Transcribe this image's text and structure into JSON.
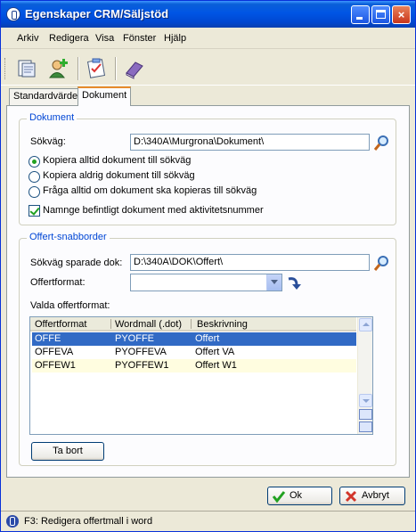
{
  "window": {
    "title": "Egenskaper CRM/Säljstöd"
  },
  "titlebar_buttons": {
    "minimize": "minimize-icon",
    "maximize": "maximize-icon",
    "close": "×"
  },
  "menu": [
    "Arkiv",
    "Redigera",
    "Visa",
    "Fönster",
    "Hjälp"
  ],
  "toolbar": {
    "icons": [
      "properties-icon",
      "add-user-icon",
      "checklist-icon",
      "book-icon"
    ]
  },
  "tabs": [
    {
      "label": "Standardvärde",
      "active": false
    },
    {
      "label": "Dokument",
      "active": true
    }
  ],
  "dokument": {
    "group_title": "Dokument",
    "path_label": "Sökväg:",
    "path_value": "D:\\340A\\Murgrona\\Dokument\\",
    "radios": [
      {
        "label": "Kopiera alltid dokument till sökväg",
        "checked": true
      },
      {
        "label": "Kopiera aldrig dokument till sökväg",
        "checked": false
      },
      {
        "label": "Fråga alltid om dokument ska kopieras till sökväg",
        "checked": false
      }
    ],
    "rename_checkbox": {
      "label": "Namnge befintligt dokument med aktivitetsnummer",
      "checked": true
    }
  },
  "offert": {
    "group_title": "Offert-snabborder",
    "saved_path_label": "Sökväg sparade dok:",
    "saved_path_value": "D:\\340A\\DOK\\Offert\\",
    "format_label": "Offertformat:",
    "format_value": "",
    "selected_label": "Valda offertformat:",
    "table": {
      "columns": [
        "Offertformat",
        "Wordmall (.dot)",
        "Beskrivning"
      ],
      "rows": [
        {
          "cells": [
            "OFFE",
            "PYOFFE",
            "Offert"
          ],
          "selected": true
        },
        {
          "cells": [
            "OFFEVA",
            "PYOFFEVA",
            "Offert VA"
          ],
          "selected": false
        },
        {
          "cells": [
            "OFFEW1",
            "PYOFFEW1",
            "Offert W1"
          ],
          "selected": false
        }
      ]
    },
    "remove_button": "Ta bort"
  },
  "buttons": {
    "ok": "Ok",
    "cancel": "Avbryt"
  },
  "status": {
    "text": "F3: Redigera offertmall i word"
  },
  "colors": {
    "title_bar": "#0055e5",
    "selection": "#316ac5",
    "group_title": "#0046d5",
    "ok_check": "#21a121",
    "cancel_x": "#d2352a"
  }
}
